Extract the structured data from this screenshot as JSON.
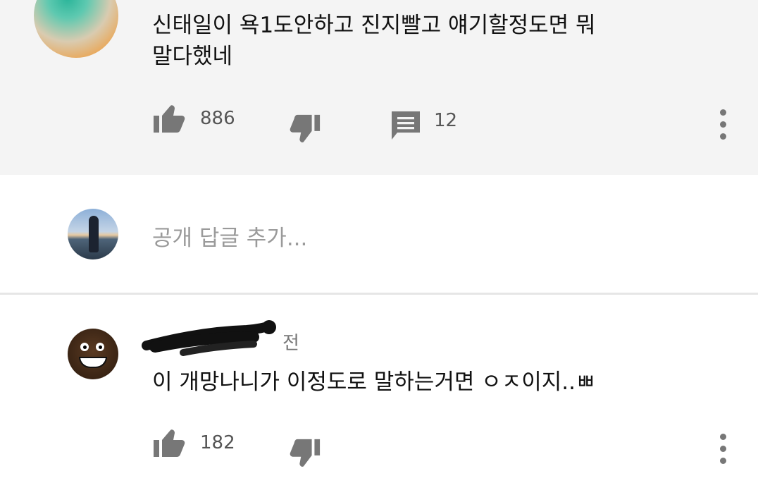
{
  "top_comment": {
    "text_line1": "신태일이 욕1도안하고 진지빨고 얘기할정도면 뭐",
    "text_line2": "말다했네",
    "likes": "886",
    "replies": "12"
  },
  "reply_box": {
    "placeholder": "공개 답글 추가..."
  },
  "reply": {
    "time_suffix": "전",
    "text": "이 개망나니가 이정도로 말하는거면 ㅇㅈ이지..ㅃ",
    "likes": "182"
  }
}
